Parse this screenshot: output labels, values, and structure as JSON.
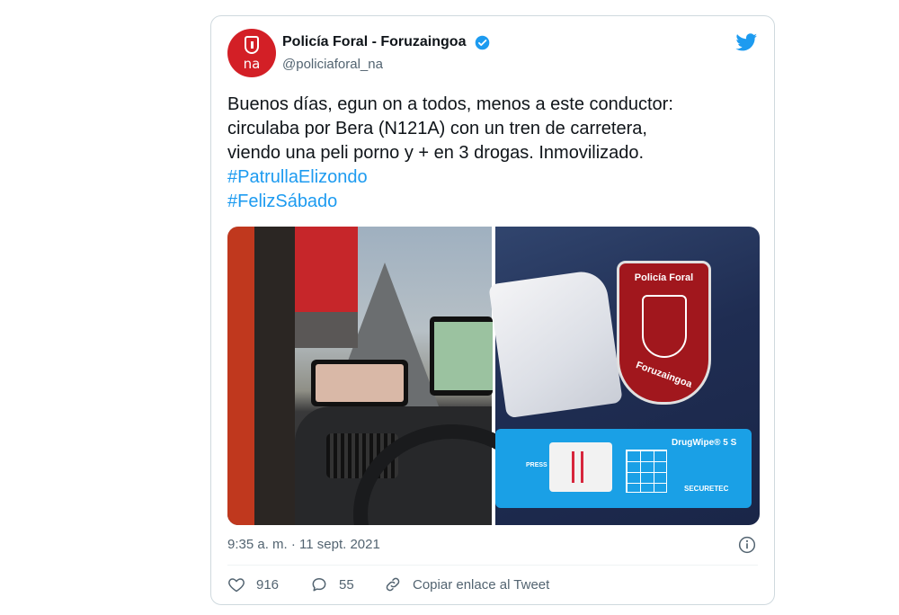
{
  "tweet": {
    "author_name": "Policía Foral - Foruzaingoa",
    "handle": "@policiaforal_na",
    "avatar_text": "na",
    "text_lines": [
      "Buenos días, egun on a todos, menos a este conductor:",
      "circulaba por Bera (N121A) con un tren de carretera,",
      "viendo una peli porno y + en 3 drogas. Inmovilizado."
    ],
    "hashtags": [
      "#PatrullaElizondo",
      "#FelizSábado"
    ],
    "timestamp": "9:35 a. m. · 11 sept. 2021",
    "likes": "916",
    "replies": "55",
    "copy_link_label": "Copiar enlace al Tweet"
  },
  "media": {
    "patch_top": "Policía Foral",
    "patch_bottom": "Foruzaingoa",
    "kit_brand": "DrugWipe® 5 S",
    "kit_press": "PRESS",
    "kit_maker": "SECURETEC"
  },
  "colors": {
    "accent": "#1d9bf0",
    "avatar": "#d31f26",
    "text": "#0f1419",
    "muted": "#536471"
  },
  "icons": [
    "verified-badge-icon",
    "twitter-bird-icon",
    "info-icon",
    "heart-icon",
    "reply-icon",
    "link-icon"
  ]
}
